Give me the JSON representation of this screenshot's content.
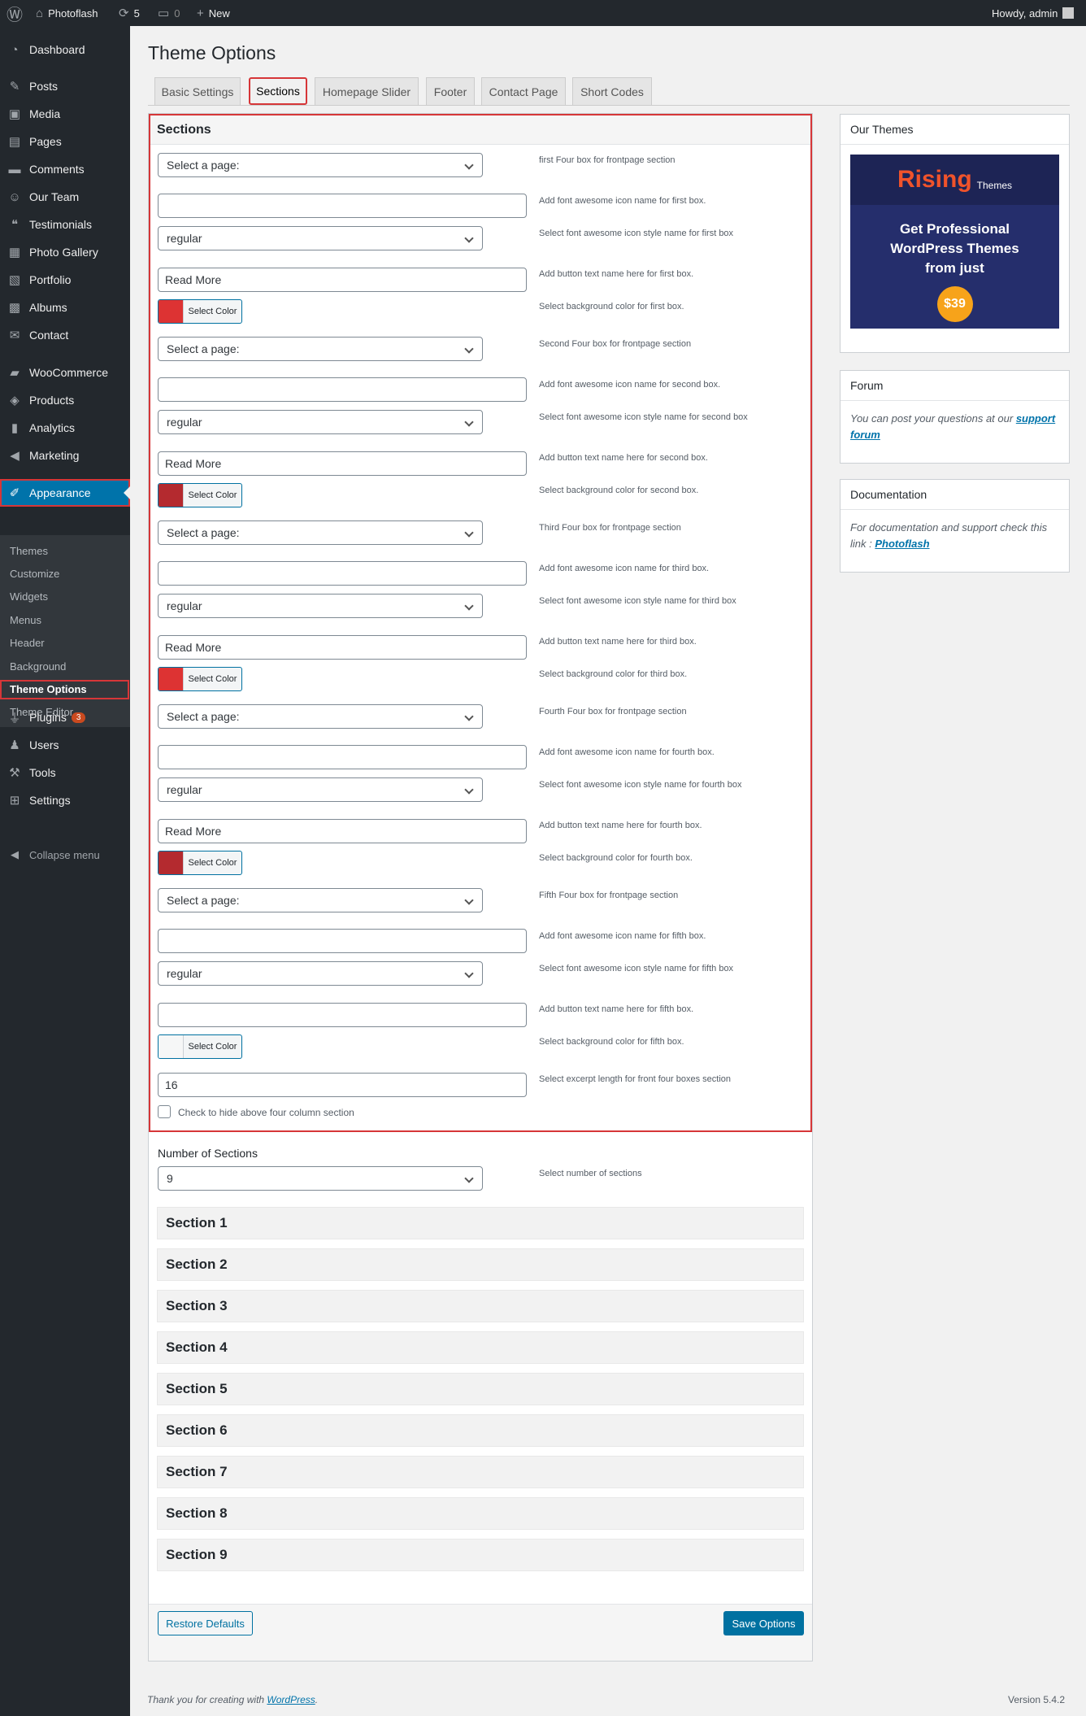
{
  "adminbar": {
    "site_name": "Photoflash",
    "updates_count": "5",
    "comments_count": "0",
    "new_label": "New",
    "howdy": "Howdy, admin"
  },
  "sidebar": {
    "items": [
      {
        "label": "Dashboard",
        "icon": "dashboard-icon"
      },
      {
        "label": "Posts",
        "icon": "pin-icon"
      },
      {
        "label": "Media",
        "icon": "media-icon"
      },
      {
        "label": "Pages",
        "icon": "pages-icon"
      },
      {
        "label": "Comments",
        "icon": "comments-icon"
      },
      {
        "label": "Our Team",
        "icon": "team-icon"
      },
      {
        "label": "Testimonials",
        "icon": "quote-icon"
      },
      {
        "label": "Photo Gallery",
        "icon": "gallery-icon"
      },
      {
        "label": "Portfolio",
        "icon": "portfolio-icon"
      },
      {
        "label": "Albums",
        "icon": "albums-icon"
      },
      {
        "label": "Contact",
        "icon": "mail-icon"
      },
      {
        "label": "WooCommerce",
        "icon": "woo-icon"
      },
      {
        "label": "Products",
        "icon": "products-icon"
      },
      {
        "label": "Analytics",
        "icon": "analytics-icon"
      },
      {
        "label": "Marketing",
        "icon": "marketing-icon"
      },
      {
        "label": "Appearance",
        "icon": "appearance-icon"
      },
      {
        "label": "Plugins",
        "icon": "plugins-icon",
        "badge": "3"
      },
      {
        "label": "Users",
        "icon": "users-icon"
      },
      {
        "label": "Tools",
        "icon": "tools-icon"
      },
      {
        "label": "Settings",
        "icon": "settings-icon"
      }
    ],
    "submenu": [
      "Themes",
      "Customize",
      "Widgets",
      "Menus",
      "Header",
      "Background",
      "Theme Options",
      "Theme Editor"
    ],
    "collapse": "Collapse menu"
  },
  "page": {
    "title": "Theme Options",
    "tabs": [
      "Basic Settings",
      "Sections",
      "Homepage Slider",
      "Footer",
      "Contact Page",
      "Short Codes"
    ]
  },
  "sections_panel": {
    "heading": "Sections",
    "select_page": "Select a page:",
    "style_value": "regular",
    "read_more": "Read More",
    "select_color": "Select Color",
    "boxes": [
      {
        "page_desc": "first Four box for frontpage section",
        "icon_desc": "Add font awesome icon name for first box.",
        "style_desc": "Select font awesome icon style name for first box",
        "btn_desc": "Add button text name here for first box.",
        "btn_value": "Read More",
        "color_desc": "Select background color for first box.",
        "color": "#dd3333"
      },
      {
        "page_desc": "Second Four box for frontpage section",
        "icon_desc": "Add font awesome icon name for second box.",
        "style_desc": "Select font awesome icon style name for second box",
        "btn_desc": "Add button text name here for second box.",
        "btn_value": "Read More",
        "color_desc": "Select background color for second box.",
        "color": "#b42a2f"
      },
      {
        "page_desc": "Third Four box for frontpage section",
        "icon_desc": "Add font awesome icon name for third box.",
        "style_desc": "Select font awesome icon style name for third box",
        "btn_desc": "Add button text name here for third box.",
        "btn_value": "Read More",
        "color_desc": "Select background color for third box.",
        "color": "#dd3333"
      },
      {
        "page_desc": "Fourth Four box for frontpage section",
        "icon_desc": "Add font awesome icon name for fourth box.",
        "style_desc": "Select font awesome icon style name for fourth box",
        "btn_desc": "Add button text name here for fourth box.",
        "btn_value": "Read More",
        "color_desc": "Select background color for fourth box.",
        "color": "#b42a2f"
      },
      {
        "page_desc": "Fifth Four box for frontpage section",
        "icon_desc": "Add font awesome icon name for fifth box.",
        "style_desc": "Select font awesome icon style name for fifth box",
        "btn_desc": "Add button text name here for fifth box.",
        "btn_value": "",
        "color_desc": "Select background color for fifth box.",
        "color": "#f6f7f7"
      }
    ],
    "excerpt_value": "16",
    "excerpt_desc": "Select excerpt length for front four boxes section",
    "hide_label": "Check to hide above four column section"
  },
  "number_sections": {
    "label": "Number of Sections",
    "value": "9",
    "desc": "Select number of sections"
  },
  "section_list": [
    "Section 1",
    "Section 2",
    "Section 3",
    "Section 4",
    "Section 5",
    "Section 6",
    "Section 7",
    "Section 8",
    "Section 9"
  ],
  "buttons": {
    "restore": "Restore Defaults",
    "save": "Save Options"
  },
  "widgets": {
    "themes_title": "Our Themes",
    "promo": {
      "logo_r": "R",
      "logo_rest": "ising",
      "logo_sub": "Themes",
      "headline": "Get Professional WordPress Themes from just",
      "price": "$39"
    },
    "forum_title": "Forum",
    "forum_text": "You can post your questions at our ",
    "forum_link": "support forum",
    "docs_title": "Documentation",
    "docs_text": "For documentation and support check this link : ",
    "docs_link": "Photoflash"
  },
  "footer": {
    "thanks": "Thank you for creating with ",
    "wp_link": "WordPress",
    "thanks_end": ".",
    "version": "Version 5.4.2"
  },
  "colors": {
    "accent": "#0073aa",
    "highlight": "#d63638",
    "sidebar_bg": "#23282d"
  }
}
